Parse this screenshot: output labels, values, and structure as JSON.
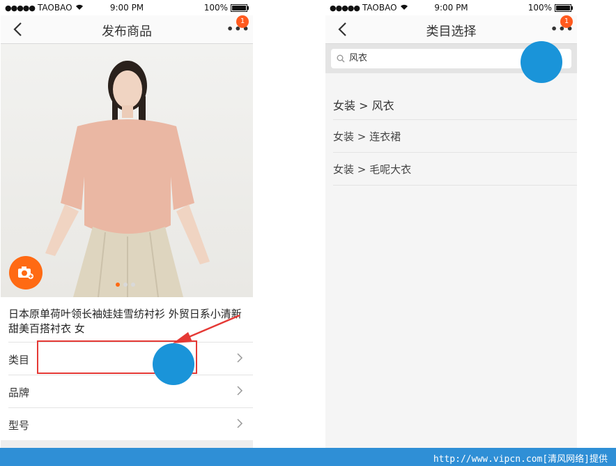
{
  "left_phone": {
    "status": {
      "carrier": "TAOBAO",
      "time": "9:00 PM",
      "battery": "100%"
    },
    "nav": {
      "title": "发布商品",
      "badge": "1"
    },
    "product_title": "日本原单荷叶领长袖娃娃雪纺衬衫 外贸日系小清新甜美百搭衬衣 女",
    "fields": [
      {
        "label": "类目"
      },
      {
        "label": "品牌"
      },
      {
        "label": "型号"
      }
    ],
    "carousel": {
      "count": 3,
      "active": 1
    }
  },
  "right_phone": {
    "status": {
      "carrier": "TAOBAO",
      "time": "9:00 PM",
      "battery": "100%"
    },
    "nav": {
      "title": "类目选择",
      "badge": "1"
    },
    "search": {
      "value": "风衣"
    },
    "categories": [
      {
        "label": "女装 > 风衣"
      },
      {
        "label": "女装 > 连衣裙"
      },
      {
        "label": "女装 > 毛呢大衣"
      }
    ]
  },
  "banner": {
    "text": "http://www.vipcn.com[清风网络]提供"
  },
  "colors": {
    "accent": "#ff6a13",
    "touch_indicator": "#1a94d9",
    "annotation": "#e53935",
    "banner": "#2f8fd6"
  }
}
